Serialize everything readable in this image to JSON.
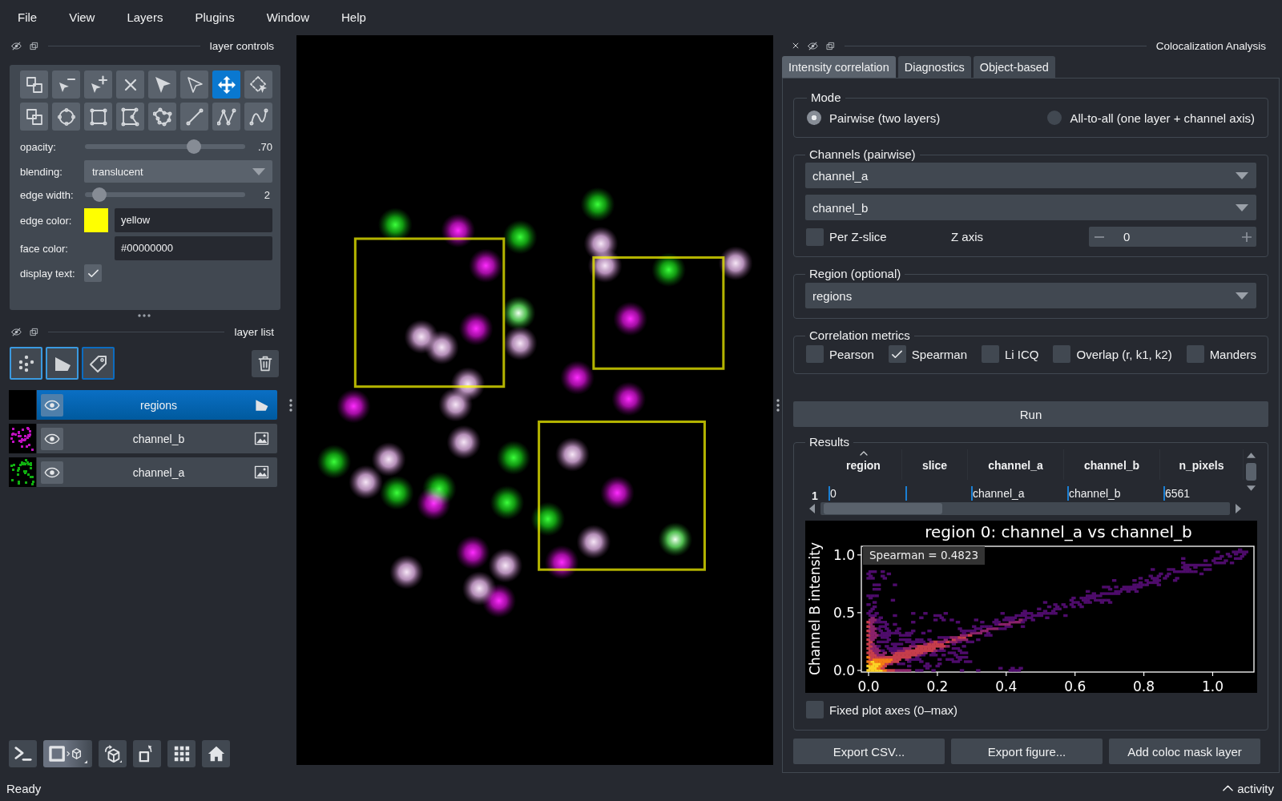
{
  "menu_bar": [
    "File",
    "View",
    "Layers",
    "Plugins",
    "Window",
    "Help"
  ],
  "layer_controls": {
    "title": "layer controls",
    "tools": [
      {
        "kind": "front",
        "selected": false
      },
      {
        "kind": "vertexremove",
        "selected": false
      },
      {
        "kind": "vertexadd",
        "selected": false
      },
      {
        "kind": "delete",
        "selected": false
      },
      {
        "kind": "select",
        "selected": false
      },
      {
        "kind": "direct",
        "selected": false
      },
      {
        "kind": "pan",
        "selected": true
      },
      {
        "kind": "lasso",
        "selected": false
      },
      {
        "kind": "back",
        "selected": false
      },
      {
        "kind": "ellipse",
        "selected": false
      },
      {
        "kind": "rectangle",
        "selected": false
      },
      {
        "kind": "polygon",
        "selected": false
      },
      {
        "kind": "polylasso",
        "selected": false
      },
      {
        "kind": "line",
        "selected": false
      },
      {
        "kind": "polyline",
        "selected": false
      },
      {
        "kind": "path",
        "selected": false
      }
    ],
    "opacity": {
      "label": "opacity:",
      "level": 0.7,
      "reading": ".70"
    },
    "blending": {
      "label": "blending:",
      "value": "translucent"
    },
    "edge_width": {
      "label": "edge width:",
      "level": 0.05,
      "reading": "2"
    },
    "edge_color": {
      "label": "edge color:",
      "color": "#ffff00",
      "value": "yellow"
    },
    "face_color": {
      "label": "face color:",
      "value": "#00000000"
    },
    "display_text": {
      "label": "display text:",
      "checked": true
    }
  },
  "layer_list": {
    "title": "layer list",
    "layers": [
      {
        "name": "regions",
        "kind": "shapes",
        "visible": true,
        "selected": true
      },
      {
        "name": "channel_b",
        "kind": "image",
        "color": "#c010c0",
        "visible": true,
        "selected": false
      },
      {
        "name": "channel_a",
        "kind": "image",
        "color": "#10b010",
        "visible": true,
        "selected": false
      }
    ]
  },
  "colocalization": {
    "title": "Colocalization Analysis",
    "tabs": [
      {
        "label": "Intensity correlation",
        "selected": true
      },
      {
        "label": "Diagnostics",
        "selected": false
      },
      {
        "label": "Object-based",
        "selected": false
      }
    ],
    "mode": {
      "title": "Mode",
      "options": [
        {
          "label": "Pairwise (two layers)",
          "selected": true
        },
        {
          "label": "All-to-all (one layer + channel axis)",
          "selected": false
        }
      ]
    },
    "channels": {
      "title": "Channels (pairwise)",
      "layer_a": "channel_a",
      "layer_b": "channel_b",
      "per_z_slice": {
        "label": "Per Z-slice",
        "checked": false
      },
      "z_axis": {
        "label": "Z axis",
        "value": "0"
      }
    },
    "region": {
      "title": "Region (optional)",
      "value": "regions"
    },
    "metrics": {
      "title": "Correlation metrics",
      "options": [
        {
          "label": "Pearson",
          "checked": false
        },
        {
          "label": "Spearman",
          "checked": true
        },
        {
          "label": "Li ICQ",
          "checked": false
        },
        {
          "label": "Overlap (r, k1, k2)",
          "checked": false
        },
        {
          "label": "Manders",
          "checked": false
        }
      ]
    },
    "run_button": "Run",
    "results": {
      "title": "Results",
      "table": {
        "columns": [
          {
            "label": "region",
            "sorted": true
          },
          {
            "label": "slice",
            "sorted": false
          },
          {
            "label": "channel_a",
            "sorted": false
          },
          {
            "label": "channel_b",
            "sorted": false
          },
          {
            "label": "n_pixels",
            "sorted": false
          }
        ],
        "rows": [
          {
            "header": "1",
            "cells": [
              {
                "text": "0"
              },
              {},
              {
                "text": "channel_a"
              },
              {
                "text": "channel_b"
              },
              {
                "text": "6561"
              }
            ]
          }
        ]
      },
      "plot": {
        "chart_data": {
          "type": "scatter",
          "title": "region 0: channel_a vs channel_b",
          "ylabel": "Channel B intensity",
          "xlim": [
            -0.021,
            1.12
          ],
          "ylim": [
            -0.014,
            1.075
          ],
          "xticks": [
            {
              "value": 0,
              "label": "0.0"
            },
            0.2,
            0.4,
            0.6,
            0.8,
            {
              "value": 1,
              "label": "1.0"
            }
          ],
          "yticks": [
            {
              "value": 0,
              "label": "0.0"
            },
            0.5,
            {
              "value": 1,
              "label": "1.0"
            }
          ],
          "annotations": [
            "Spearman = 0.4823"
          ]
        }
      },
      "fixed_axes": {
        "label": "Fixed plot axes (0–max)",
        "checked": false
      }
    },
    "buttons": [
      "Export CSV...",
      "Export figure...",
      "Add coloc mask layer"
    ]
  },
  "status_bar": {
    "message": "Ready",
    "activity": "activity"
  }
}
